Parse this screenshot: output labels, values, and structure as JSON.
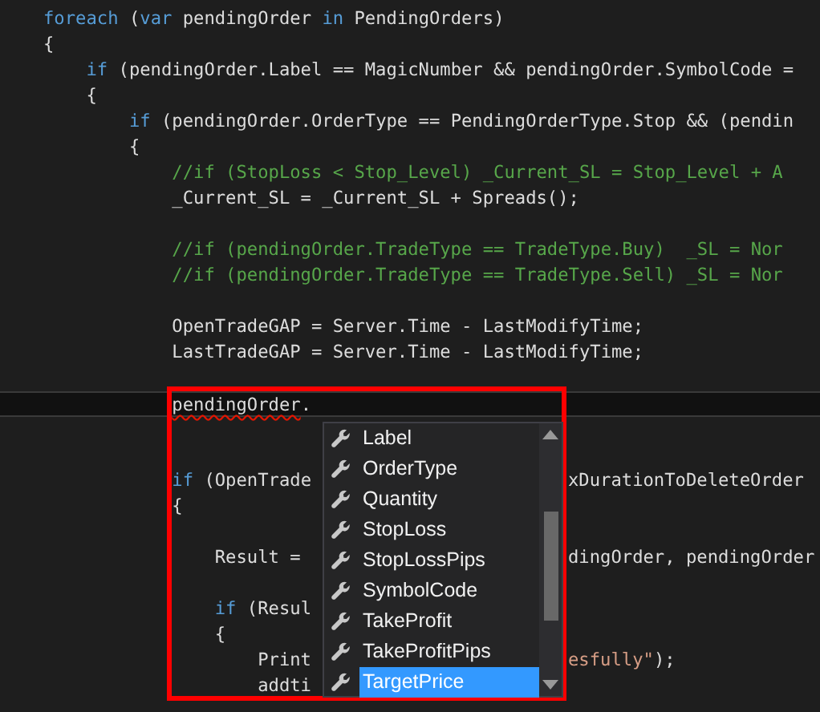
{
  "editor": {
    "lines": [
      {
        "tokens": [
          {
            "text": "foreach",
            "kind": "keyword"
          },
          {
            "text": " (",
            "kind": "plain"
          },
          {
            "text": "var",
            "kind": "keyword"
          },
          {
            "text": " pendingOrder ",
            "kind": "plain"
          },
          {
            "text": "in",
            "kind": "keyword"
          },
          {
            "text": " PendingOrders)",
            "kind": "plain"
          }
        ]
      },
      {
        "tokens": [
          {
            "text": "{",
            "kind": "plain"
          }
        ]
      },
      {
        "tokens": [
          {
            "text": "    if",
            "kind": "keyword"
          },
          {
            "text": " (pendingOrder.Label == MagicNumber && pendingOrder.SymbolCode =",
            "kind": "plain"
          }
        ]
      },
      {
        "tokens": [
          {
            "text": "    {",
            "kind": "plain"
          }
        ]
      },
      {
        "tokens": [
          {
            "text": "        if",
            "kind": "keyword"
          },
          {
            "text": " (pendingOrder.OrderType == PendingOrderType.Stop && (pendin",
            "kind": "plain"
          }
        ]
      },
      {
        "tokens": [
          {
            "text": "        {",
            "kind": "plain"
          }
        ]
      },
      {
        "tokens": [
          {
            "text": "            //if (StopLoss < Stop_Level) _Current_SL = Stop_Level + A",
            "kind": "comment"
          }
        ]
      },
      {
        "tokens": [
          {
            "text": "            _Current_SL = _Current_SL + Spreads();",
            "kind": "plain"
          }
        ]
      },
      {
        "kind": "blank"
      },
      {
        "tokens": [
          {
            "text": "            //if (pendingOrder.TradeType == TradeType.Buy)  _SL = Nor",
            "kind": "comment"
          }
        ]
      },
      {
        "tokens": [
          {
            "text": "            //if (pendingOrder.TradeType == TradeType.Sell) _SL = Nor",
            "kind": "comment"
          }
        ]
      },
      {
        "kind": "blank"
      },
      {
        "tokens": [
          {
            "text": "            OpenTradeGAP = Server.Time - LastModifyTime;",
            "kind": "plain"
          }
        ]
      },
      {
        "tokens": [
          {
            "text": "            LastTradeGAP = Server.Time - LastModifyTime;",
            "kind": "plain"
          }
        ]
      },
      {
        "kind": "blank"
      },
      {
        "kind": "code",
        "current": true,
        "tokens": [
          {
            "text": "            pendingOrder",
            "kind": "plain",
            "squiggle": true
          },
          {
            "text": ".",
            "kind": "plain"
          }
        ]
      },
      {
        "kind": "blank"
      },
      {
        "kind": "blank"
      },
      {
        "tokens": [
          {
            "text": "            if",
            "kind": "keyword"
          },
          {
            "text": " (OpenTrade",
            "kind": "plain"
          }
        ],
        "tail": [
          {
            "text": "xDurationToDeleteOrder",
            "kind": "plain"
          }
        ]
      },
      {
        "tokens": [
          {
            "text": "            {",
            "kind": "plain"
          }
        ]
      },
      {
        "kind": "blank"
      },
      {
        "tokens": [
          {
            "text": "                Result = ",
            "kind": "plain"
          }
        ],
        "tail": [
          {
            "text": "dingOrder, pendingOrder",
            "kind": "plain"
          }
        ]
      },
      {
        "kind": "blank"
      },
      {
        "tokens": [
          {
            "text": "                if",
            "kind": "keyword"
          },
          {
            "text": " (Resul",
            "kind": "plain"
          }
        ]
      },
      {
        "tokens": [
          {
            "text": "                {",
            "kind": "plain"
          }
        ]
      },
      {
        "tokens": [
          {
            "text": "                    Print",
            "kind": "plain"
          }
        ],
        "tail": [
          {
            "text": "esfully\"",
            "kind": "string"
          },
          {
            "text": ");",
            "kind": "plain"
          }
        ]
      },
      {
        "tokens": [
          {
            "text": "                    addti",
            "kind": "plain"
          }
        ]
      }
    ]
  },
  "completion": {
    "items": [
      {
        "label": "Label",
        "selected": false
      },
      {
        "label": "OrderType",
        "selected": false
      },
      {
        "label": "Quantity",
        "selected": false
      },
      {
        "label": "StopLoss",
        "selected": false
      },
      {
        "label": "StopLossPips",
        "selected": false
      },
      {
        "label": "SymbolCode",
        "selected": false
      },
      {
        "label": "TakeProfit",
        "selected": false
      },
      {
        "label": "TakeProfitPips",
        "selected": false
      },
      {
        "label": "TargetPrice",
        "selected": true
      }
    ]
  }
}
